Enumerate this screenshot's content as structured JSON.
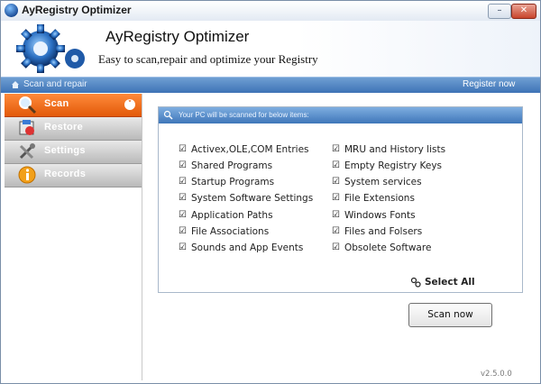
{
  "window": {
    "title": "AyRegistry Optimizer",
    "minimize_icon": "minimize-icon",
    "close_icon": "close-icon"
  },
  "header": {
    "app_title": "AyRegistry Optimizer",
    "tagline": "Easy to scan,repair and optimize your Registry"
  },
  "navbar": {
    "left": "Scan and repair",
    "right": "Register now"
  },
  "sidebar": {
    "items": [
      {
        "label": "Scan",
        "icon": "magnifier-icon",
        "active": true
      },
      {
        "label": "Restore",
        "icon": "restore-icon",
        "active": false
      },
      {
        "label": "Settings",
        "icon": "settings-icon",
        "active": false
      },
      {
        "label": "Records",
        "icon": "info-icon",
        "active": false
      }
    ]
  },
  "panel": {
    "header": "Your PC will be scanned for below items:",
    "left_items": [
      "Activex,OLE,COM Entries",
      "Shared Programs",
      "Startup Programs",
      "System Software Settings",
      "Application Paths",
      "File Associations",
      "Sounds and App Events"
    ],
    "right_items": [
      "MRU and History lists",
      "Empty Registry Keys",
      "System services",
      "File Extensions",
      "Windows Fonts",
      "Files and Folsers",
      "Obsolete Software"
    ],
    "select_all": "Select All"
  },
  "actions": {
    "scan_now": "Scan now"
  },
  "footer": {
    "version": "v2.5.0.0"
  },
  "colors": {
    "accent_orange": "#e25a0a",
    "nav_blue": "#3e73b6",
    "sidebar_gray": "#b9b9b9"
  }
}
